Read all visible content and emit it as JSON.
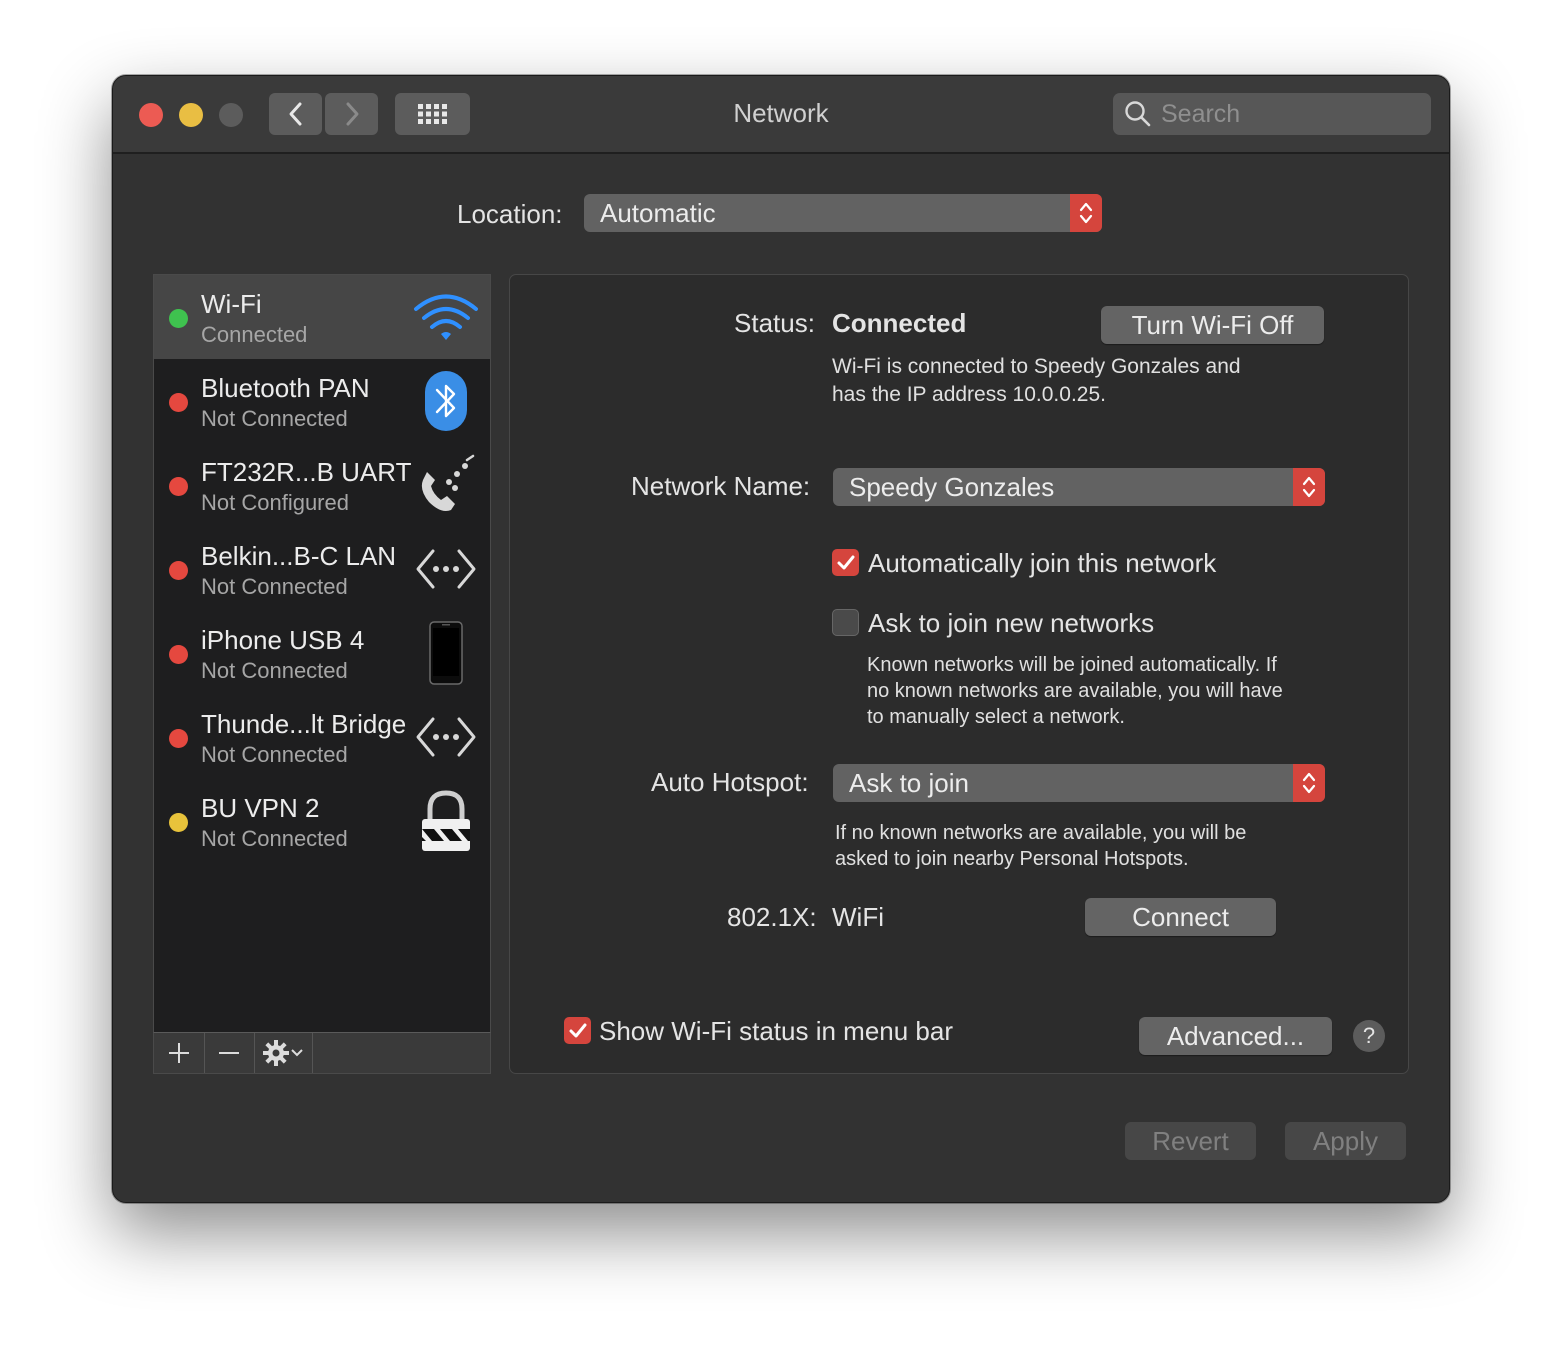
{
  "window": {
    "title": "Network",
    "search_placeholder": "Search"
  },
  "location": {
    "label": "Location:",
    "value": "Automatic"
  },
  "services": [
    {
      "name": "Wi-Fi",
      "status": "Connected",
      "dot_color": "#3fc24f",
      "icon": "wifi-icon"
    },
    {
      "name": "Bluetooth PAN",
      "status": "Not Connected",
      "dot_color": "#e5483f",
      "icon": "bluetooth-icon"
    },
    {
      "name": "FT232R...B UART",
      "status": "Not Configured",
      "dot_color": "#e5483f",
      "icon": "phone-modem-icon"
    },
    {
      "name": "Belkin...B-C LAN",
      "status": "Not Connected",
      "dot_color": "#e5483f",
      "icon": "ethernet-arrows-icon"
    },
    {
      "name": "iPhone USB 4",
      "status": "Not Connected",
      "dot_color": "#e5483f",
      "icon": "iphone-icon"
    },
    {
      "name": "Thunde...lt Bridge",
      "status": "Not Connected",
      "dot_color": "#e5483f",
      "icon": "ethernet-arrows-icon"
    },
    {
      "name": "BU VPN 2",
      "status": "Not Connected",
      "dot_color": "#e8c33b",
      "icon": "vpn-lock-icon"
    }
  ],
  "detail": {
    "status_label": "Status:",
    "status_value": "Connected",
    "turn_off_button": "Turn Wi-Fi Off",
    "status_desc_1": "Wi-Fi is connected to Speedy Gonzales and",
    "status_desc_2": "has the IP address 10.0.0.25.",
    "network_name_label": "Network Name:",
    "network_name_value": "Speedy Gonzales",
    "auto_join_label": "Automatically join this network",
    "auto_join_checked": true,
    "ask_join_label": "Ask to join new networks",
    "ask_join_checked": false,
    "ask_join_desc_1": "Known networks will be joined automatically. If",
    "ask_join_desc_2": "no known networks are available, you will have",
    "ask_join_desc_3": "to manually select a network.",
    "hotspot_label": "Auto Hotspot:",
    "hotspot_value": "Ask to join",
    "hotspot_desc_1": "If no known networks are available, you will be",
    "hotspot_desc_2": "asked to join nearby Personal Hotspots.",
    "dot1x_label": "802.1X:",
    "dot1x_value": "WiFi",
    "connect_button": "Connect",
    "show_status_label": "Show Wi-Fi status in menu bar",
    "show_status_checked": true,
    "advanced_button": "Advanced...",
    "help_glyph": "?"
  },
  "footer": {
    "revert_button": "Revert",
    "apply_button": "Apply"
  },
  "colors": {
    "accent": "#d5453d",
    "window_bg": "#323232",
    "sidebar_bg": "#1e1e1f"
  }
}
